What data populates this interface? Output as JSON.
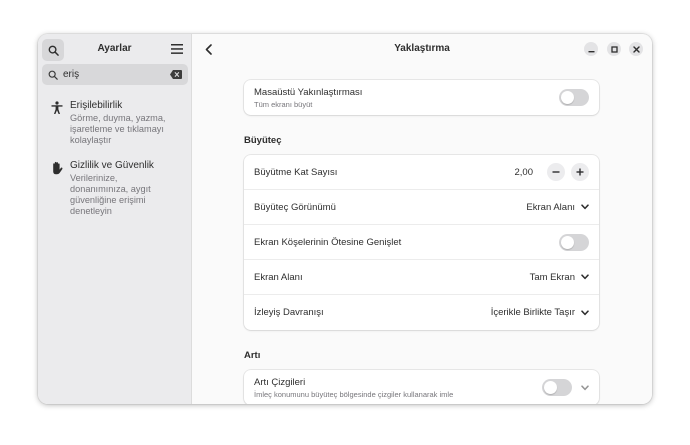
{
  "sidebar": {
    "title": "Ayarlar",
    "search": {
      "value": "eriş"
    },
    "results": [
      {
        "label": "Erişilebilirlik",
        "description": "Görme, duyma, yazma, işaretleme ve tıklamayı kolaylaştır",
        "lines": [
          "Görme, duyma, yazma,",
          "işaretleme ve tıklamayı",
          "kolaylaştır"
        ],
        "icon": "accessibility-icon"
      },
      {
        "label": "Gizlilik ve Güvenlik",
        "description": "Verilerinize, donanımınıza, aygıt güvenliğine erişimi denetleyin",
        "lines": [
          "Verilerinize,",
          "donanımınıza, aygıt",
          "güvenliğine erişimi",
          "denetleyin"
        ],
        "icon": "hand-icon"
      }
    ]
  },
  "header": {
    "title": "Yaklaştırma"
  },
  "desktop_zoom": {
    "label": "Masaüstü Yakınlaştırması",
    "sublabel": "Tüm ekranı büyüt",
    "enabled": false
  },
  "magnifier": {
    "section_title": "Büyüteç",
    "factor_label": "Büyütme Kat Sayısı",
    "factor_value": "2,00",
    "view_label": "Büyüteç Görünümü",
    "view_value": "Ekran Alanı",
    "extend_label": "Ekran Köşelerinin Ötesine Genişlet",
    "extend_enabled": false,
    "area_label": "Ekran Alanı",
    "area_value": "Tam Ekran",
    "tracking_label": "İzleyiş Davranışı",
    "tracking_value": "İçerikle Birlikte Taşır"
  },
  "crosshairs": {
    "section_title": "Artı",
    "label": "Artı Çizgileri",
    "sublabel": "İmleç konumunu büyüteç bölgesinde çizgiler kullanarak imle",
    "enabled": false
  }
}
